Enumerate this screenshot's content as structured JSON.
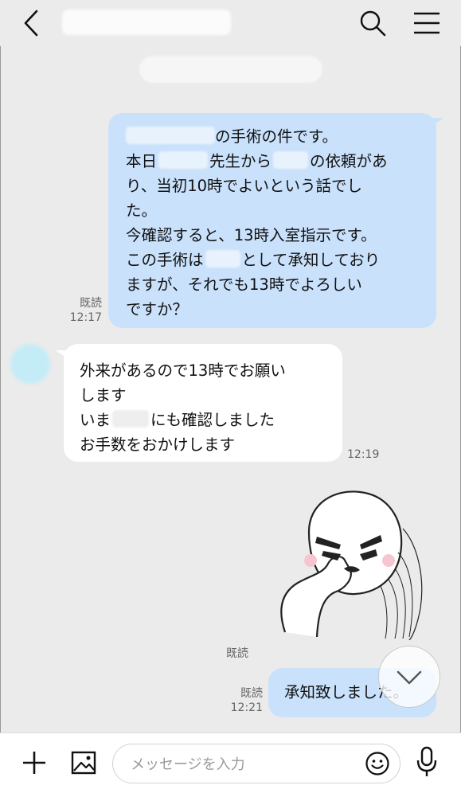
{
  "header": {
    "back_icon": "chevron-left-icon",
    "search_icon": "search-icon",
    "menu_icon": "hamburger-menu-icon"
  },
  "messages": {
    "outgoing_1": {
      "lines": [
        "の手術の件です。",
        "本日",
        "先生から",
        "の依頼があ",
        "り、当初10時でよいという話でし",
        "た。",
        "今確認すると、13時入室指示です。",
        "この手術は",
        "として承知しており",
        "ますが、それでも13時でよろしい",
        "ですか？"
      ],
      "read_label": "既読",
      "time": "12:17"
    },
    "incoming_1": {
      "lines": [
        "外来があるので13時でお願い",
        "します",
        "いま",
        "にも確認しました",
        "お手数をおかけします"
      ],
      "time": "12:19"
    },
    "sticker": {
      "read_label": "既読"
    },
    "outgoing_2": {
      "text": "承知致しました。",
      "read_label": "既読",
      "time": "12:21"
    }
  },
  "composer": {
    "placeholder": "メッセージを入力",
    "plus_icon": "plus-icon",
    "image_icon": "image-icon",
    "emoji_icon": "smiley-icon",
    "mic_icon": "microphone-icon"
  },
  "colors": {
    "background": "#ebebeb",
    "outgoing_bubble": "#c9e1fb",
    "incoming_bubble": "#ffffff"
  }
}
